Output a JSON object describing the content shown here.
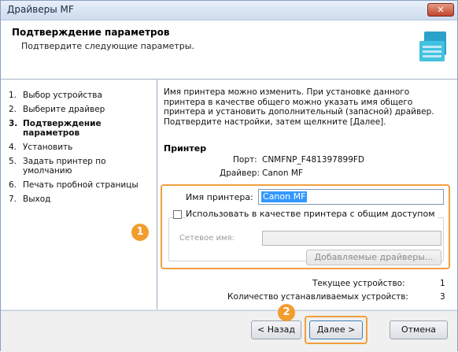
{
  "window": {
    "title": "Драйверы MF",
    "close_label": "✕"
  },
  "header": {
    "title": "Подтверждение параметров",
    "subtitle": "Подтвердите следующие параметры."
  },
  "steps": [
    {
      "num": "1.",
      "label": "Выбор устройства"
    },
    {
      "num": "2.",
      "label": "Выберите драйвер"
    },
    {
      "num": "3.",
      "label": "Подтверждение параметров"
    },
    {
      "num": "4.",
      "label": "Установить"
    },
    {
      "num": "5.",
      "label": "Задать принтер по умолчанию"
    },
    {
      "num": "6.",
      "label": "Печать пробной страницы"
    },
    {
      "num": "7.",
      "label": "Выход"
    }
  ],
  "main": {
    "intro": "Имя принтера можно изменить. При установке данного принтера в качестве общего можно указать имя общего принтера и установить дополнительный (запасной) драйвер. Подтвердите настройки, затем щелкните [Далее].",
    "printer_section": "Принтер",
    "port_label": "Порт:",
    "port_value": "CNMFNP_F481397899FD",
    "driver_label": "Драйвер:",
    "driver_value": "Canon MF",
    "printer_name_label": "Имя принтера:",
    "printer_name_value": "Canon MF",
    "share_checkbox_label": "Использовать в качестве принтера с общим доступом",
    "share_checked": false,
    "network_name_label": "Сетевое имя:",
    "network_name_value": "",
    "additional_drivers_button": "Добавляемые драйверы...",
    "current_device_label": "Текущее устройство:",
    "current_device_value": "1",
    "devices_count_label": "Количество устанавливаемых устройств:",
    "devices_count_value": "3"
  },
  "footer": {
    "back_label": "< Назад",
    "next_label": "Далее >",
    "cancel_label": "Отмена"
  },
  "annotations": {
    "badge1": "1",
    "badge2": "2",
    "color": "#f39c2e"
  }
}
